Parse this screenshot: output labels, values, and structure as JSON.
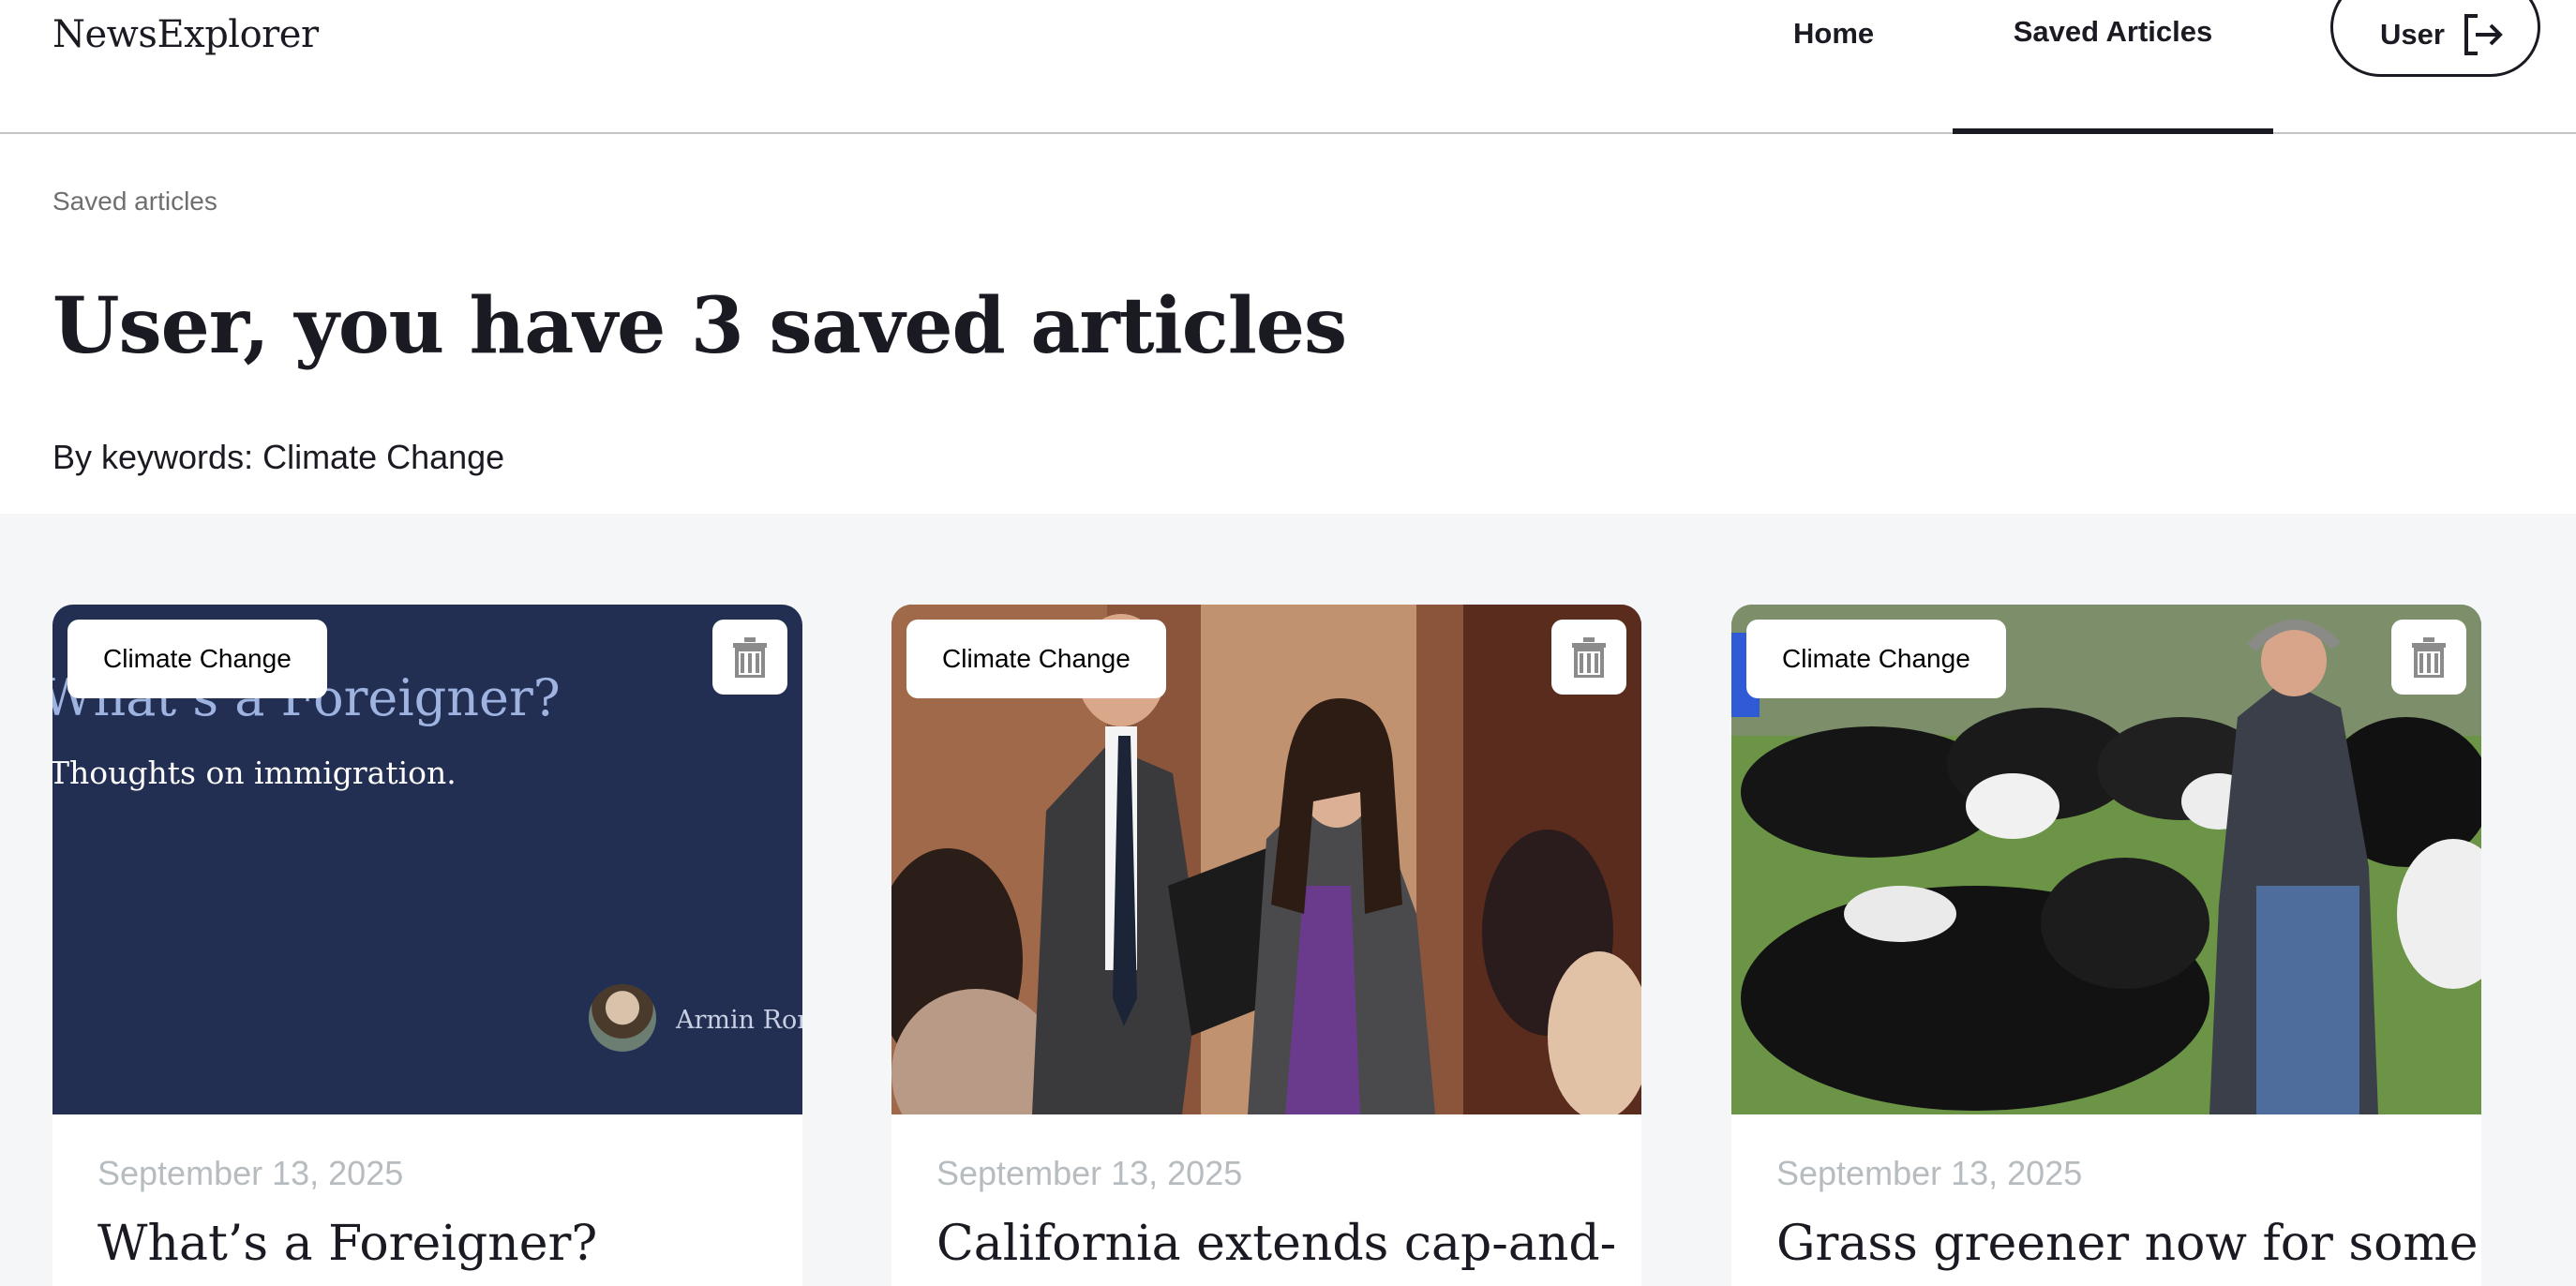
{
  "header": {
    "logo": "NewsExplorer",
    "nav": {
      "home": "Home",
      "saved": "Saved Articles"
    },
    "user_button": "User"
  },
  "page": {
    "breadcrumb": "Saved articles",
    "title": "User, you have 3 saved articles",
    "keywords": "By keywords: Climate Change"
  },
  "articles": [
    {
      "tag": "Climate Change",
      "date": "September 13, 2025",
      "title": "What’s a Foreigner?",
      "image_text": {
        "heading": "What’s a Foreigner?",
        "subheading": "Thoughts on immigration.",
        "author": "Armin Rona"
      }
    },
    {
      "tag": "Climate Change",
      "date": "September 13, 2025",
      "title": "California extends cap-and-"
    },
    {
      "tag": "Climate Change",
      "date": "September 13, 2025",
      "title": "Grass greener now for some"
    }
  ]
}
